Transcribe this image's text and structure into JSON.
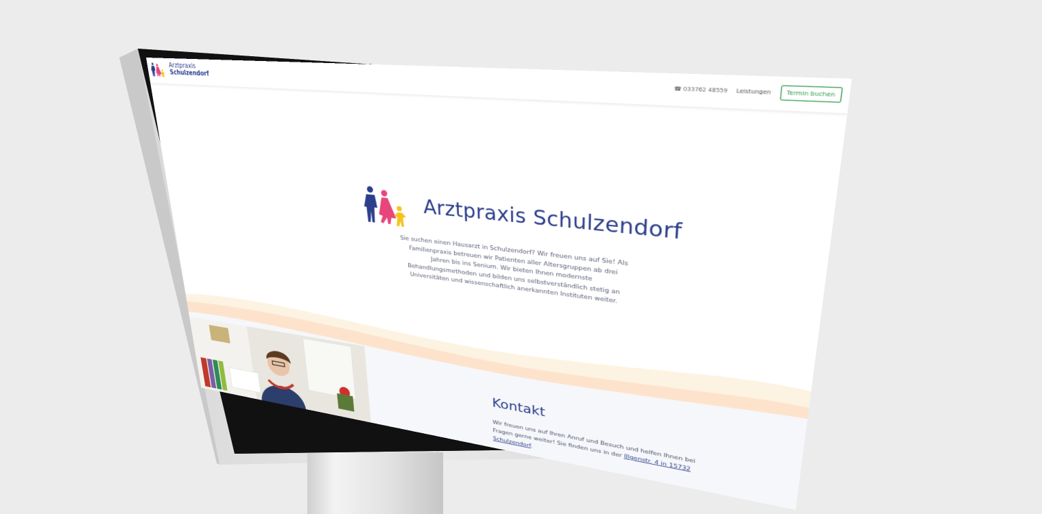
{
  "header": {
    "brand_line1": "Arztpraxis",
    "brand_line2": "Schulzendorf",
    "phone": "☎ 033762 48559",
    "nav_leistungen": "Leistungen",
    "cta_button": "Termin buchen"
  },
  "hero": {
    "title": "Arztpraxis Schulzendorf",
    "text": "Sie suchen einen Hausarzt in Schulzendorf? Wir freuen uns auf Sie! Als Familienpraxis betreuen wir Patienten aller Altersgruppen ab drei Jahren bis ins Senium. Wir bieten Ihnen modernste Behandlungsmethoden und bilden uns selbstverständlich stetig an Universitäten und wissenschaftlich anerkannten Instituten weiter."
  },
  "contact": {
    "title": "Kontakt",
    "text_before": "Wir freuen uns auf Ihren Anruf und Besuch und helfen Ihnen bei Fragen gerne weiter! Sie finden uns in der ",
    "address_link": "Illgenstr. 4 in 15732 Schulzendorf",
    "text_after": "."
  },
  "colors": {
    "brand_blue": "#2c3e8c",
    "accent_pink": "#e8457c",
    "accent_yellow": "#f5c31c",
    "cta_green": "#2f9a4a"
  }
}
